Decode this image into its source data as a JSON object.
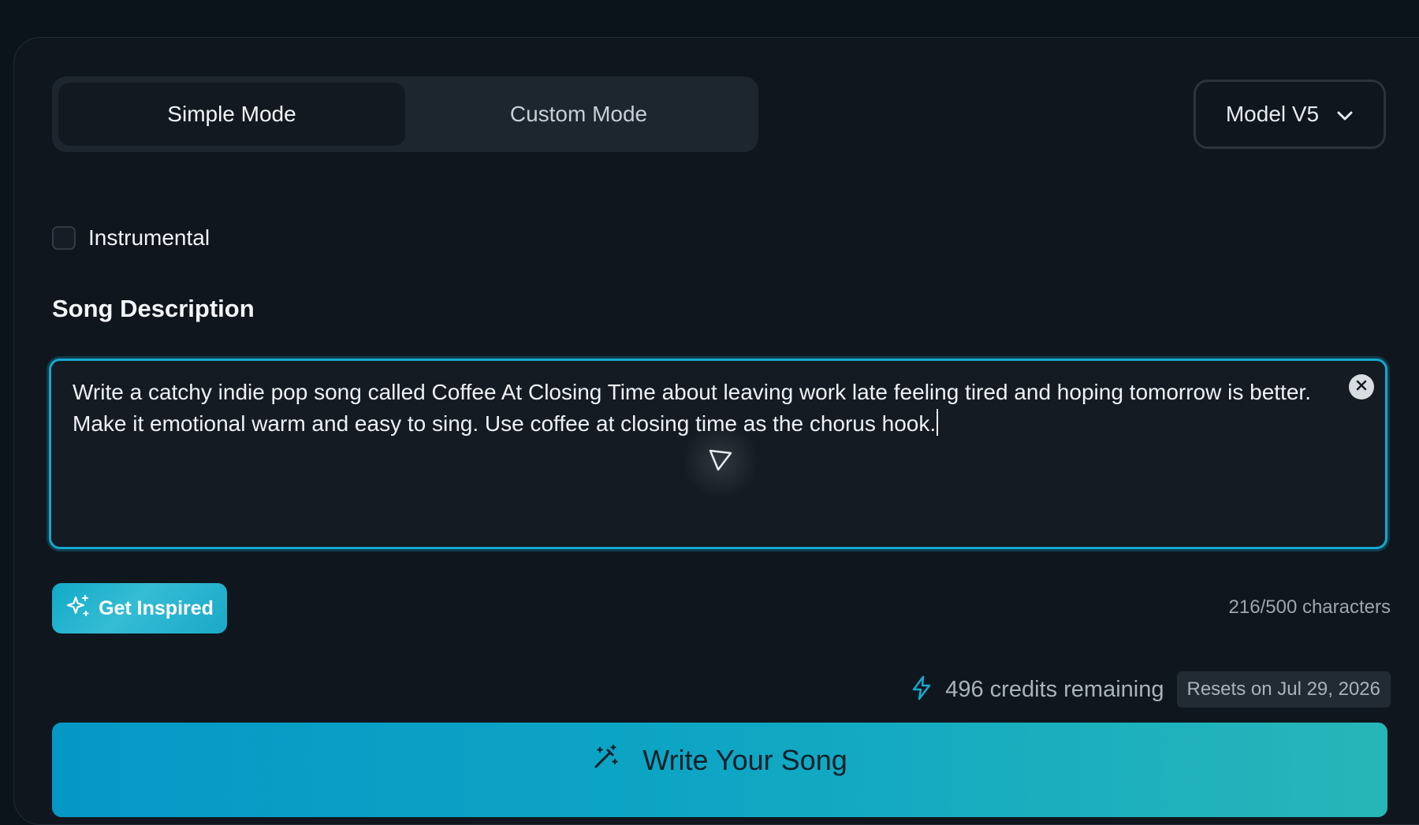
{
  "mode_toggle": {
    "simple_label": "Simple Mode",
    "custom_label": "Custom Mode",
    "selected": "Simple Mode"
  },
  "model_select": {
    "label": "Model V5",
    "icon": "chevron-down-icon"
  },
  "instrumental": {
    "label": "Instrumental",
    "checked": false
  },
  "song_description": {
    "title": "Song Description",
    "value": "Write a catchy indie pop song called Coffee At Closing Time about leaving work late feeling tired and hoping tomorrow is better. Make it emotional warm and easy to sing. Use coffee at closing time as the chorus hook.",
    "char_count": "216/500 characters"
  },
  "inspire": {
    "label": "Get Inspired",
    "icon": "sparkles-icon"
  },
  "credits": {
    "text": "496 credits remaining",
    "reset": "Resets on Jul 29, 2026",
    "icon": "lightning-icon"
  },
  "write_button": {
    "label": "Write Your Song",
    "icon": "magic-wand-icon"
  },
  "colors": {
    "background": "#0b131b",
    "panel": "#0f161d",
    "accent": "#15a9cf",
    "button_gradient_start": "#0598c6",
    "button_gradient_end": "#27b6b8"
  }
}
